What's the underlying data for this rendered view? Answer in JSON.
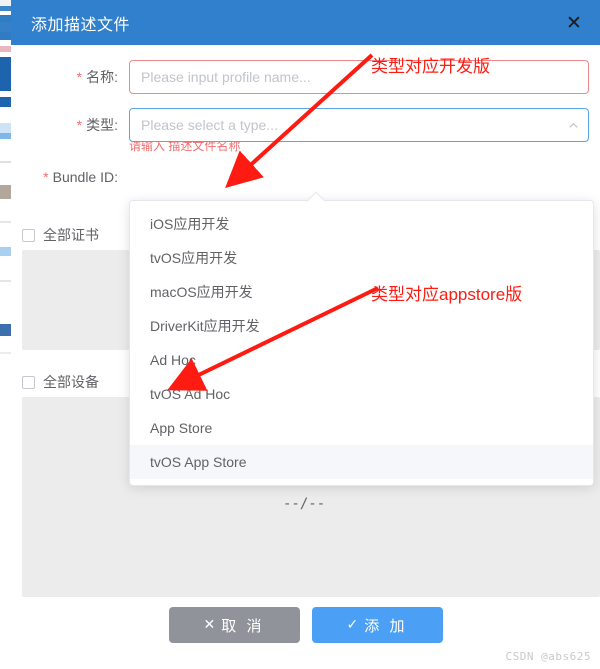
{
  "window": {
    "title": "添加描述文件",
    "close_icon": "close-icon",
    "header_color": "#3080cd"
  },
  "form": {
    "name_field": {
      "label": "名称:",
      "required_mark": "*",
      "placeholder": "Please input profile name...",
      "value": "",
      "error": "请输入 描述文件名称",
      "border_color": "#f08a8a"
    },
    "type_field": {
      "label": "类型:",
      "required_mark": "*",
      "placeholder": "Please select a type...",
      "value": "",
      "caret_icon": "chevron-up-icon",
      "border_color": "#5aa4ef"
    },
    "bundle_id_field": {
      "label": "Bundle ID:",
      "required_mark": "*"
    },
    "all_certs": {
      "label": "全部证书",
      "checked": false
    },
    "all_devices": {
      "label": "全部设备",
      "checked": false
    },
    "empty_placeholder": "--/--"
  },
  "dropdown": {
    "open": true,
    "highlighted_index": 7,
    "options": [
      "iOS应用开发",
      "tvOS应用开发",
      "macOS应用开发",
      "DriverKit应用开发",
      "Ad Hoc",
      "tvOS Ad Hoc",
      "App Store",
      "tvOS App Store"
    ]
  },
  "footer": {
    "cancel_label": "取 消",
    "cancel_icon": "✕",
    "add_label": "添 加",
    "add_icon": "✓",
    "cancel_color": "#909399",
    "add_color": "#4ba0f5"
  },
  "annotations": [
    {
      "text": "类型对应开发版",
      "color": "#fd1b12"
    },
    {
      "text": "类型对应appstore版",
      "color": "#fd1b12"
    }
  ],
  "watermark": "CSDN @abs625"
}
